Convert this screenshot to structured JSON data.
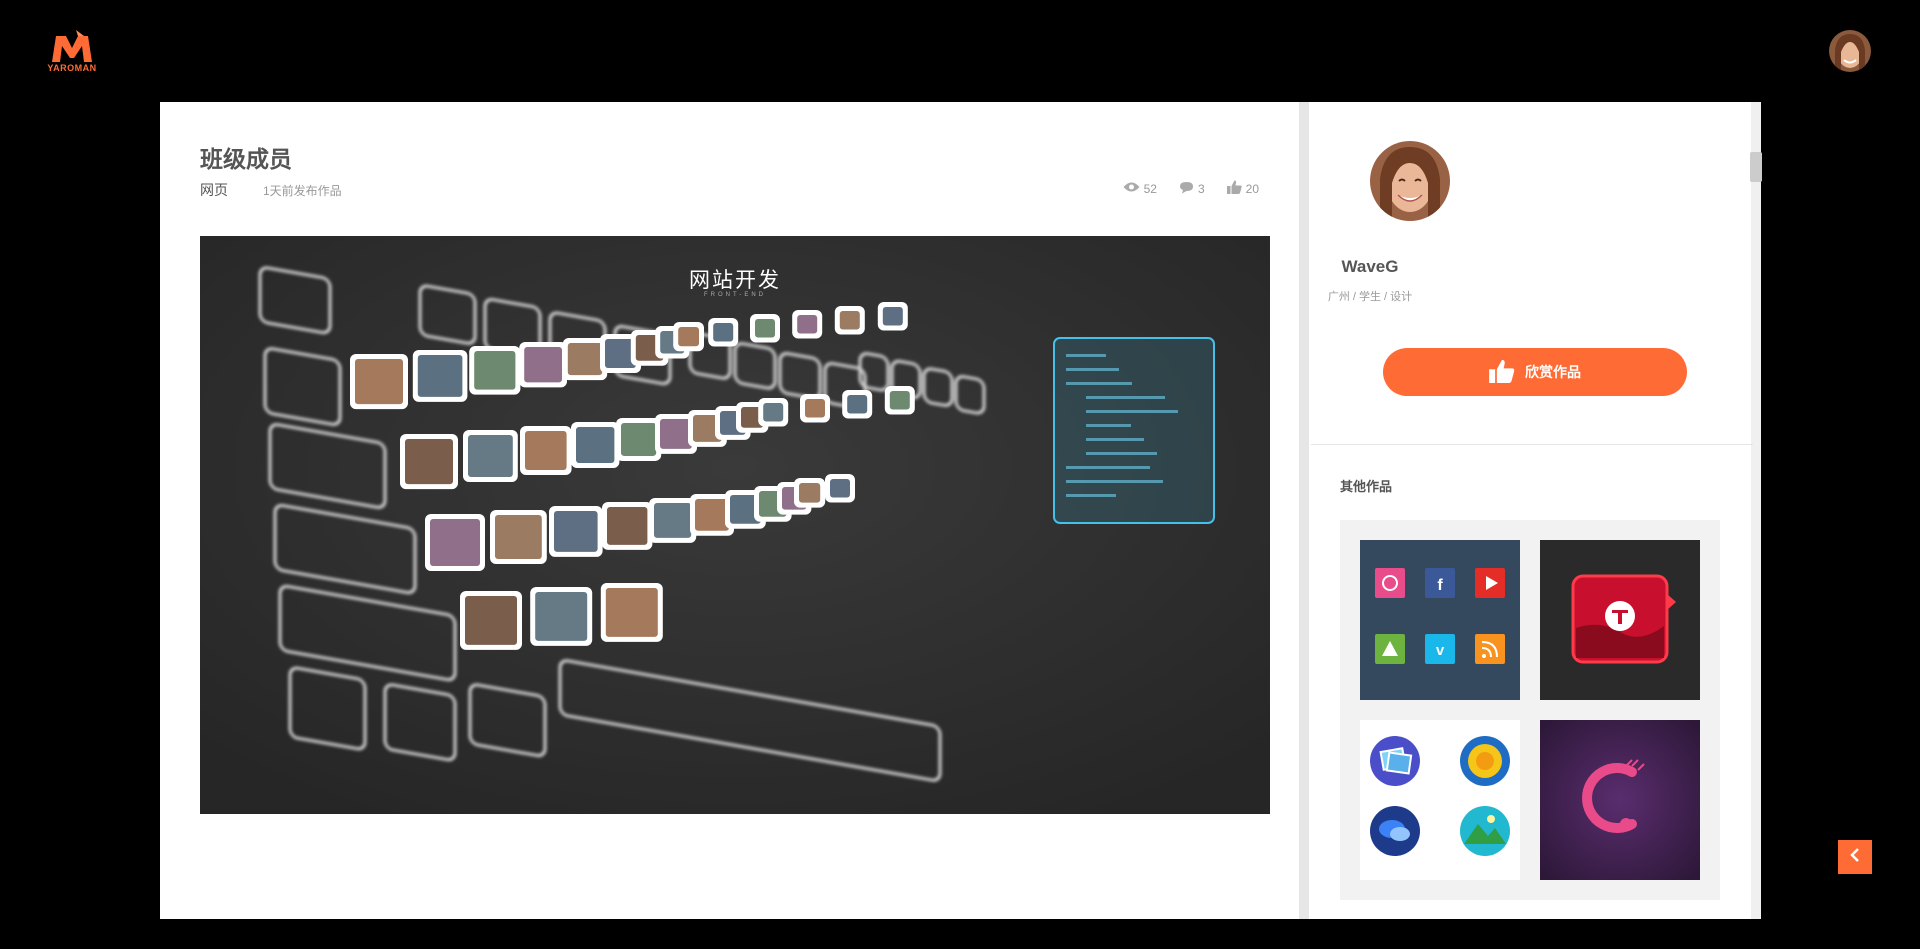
{
  "brand": {
    "logo_text": "YAROMAN",
    "accent": "#ff6b35"
  },
  "work": {
    "title": "班级成员",
    "category": "网页",
    "published": "1天前发布作品",
    "views": "52",
    "comments": "3",
    "likes": "20"
  },
  "hero": {
    "title": "网站开发",
    "subtitle": "FRONT-END"
  },
  "author": {
    "name": "WaveG",
    "city": "广州",
    "role": "学生",
    "field": "设计",
    "meta": "广州 / 学生 / 设计"
  },
  "actions": {
    "appreciate": "欣赏作品"
  },
  "others": {
    "label": "其他作品",
    "items": [
      "social-icons",
      "red-t-logo",
      "round-badges",
      "purple-c-logo"
    ]
  },
  "icons": {
    "views": "eye-icon",
    "comments": "comment-icon",
    "likes": "thumb-up-icon",
    "back": "chevron-left-icon"
  }
}
